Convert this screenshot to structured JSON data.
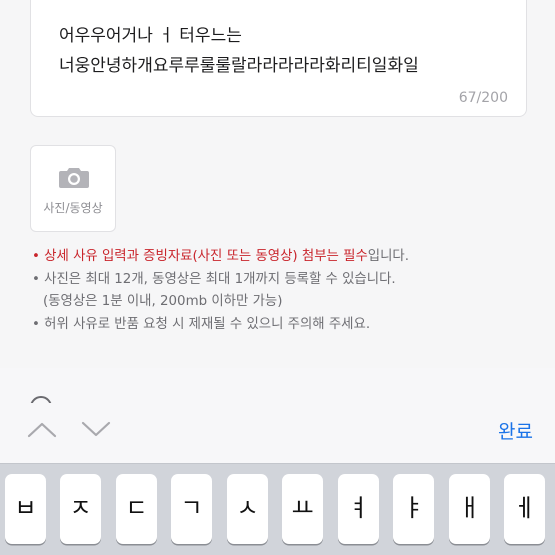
{
  "textbox": {
    "line1": "어우우어거나 ㅓ 터우느는",
    "line2": "너웅안녕하개요루루룰룰랄라라라라라화리티일화일",
    "counter": "67/200"
  },
  "photo_button": {
    "label": "사진/동영상",
    "icon": "camera-icon"
  },
  "notes": {
    "bullet": "•",
    "line1_emphasis": "상세 사유 입력과 증빙자료(사진 또는 동영상) 첨부는 필수",
    "line1_rest": "입니다.",
    "line2": "사진은 최대 12개, 동영상은 최대 1개까지 등록할 수 있습니다.",
    "line3": "(동영상은 1분 이내, 200mb 이하만 가능)",
    "line4": "허위 사유로 반품 요청 시 제재될 수 있으니 주의해 주세요."
  },
  "keyboard_toolbar": {
    "prev_icon": "chevron-up-icon",
    "next_icon": "chevron-down-icon",
    "done_label": "완료"
  },
  "keyboard_keys": [
    "ㅂ",
    "ㅈ",
    "ㄷ",
    "ㄱ",
    "ㅅ",
    "ㅛ",
    "ㅕ",
    "ㅑ",
    "ㅐ",
    "ㅔ"
  ],
  "colors": {
    "accent": "#1a73e8",
    "emphasis": "#c9252c",
    "muted": "#6e6e73"
  }
}
